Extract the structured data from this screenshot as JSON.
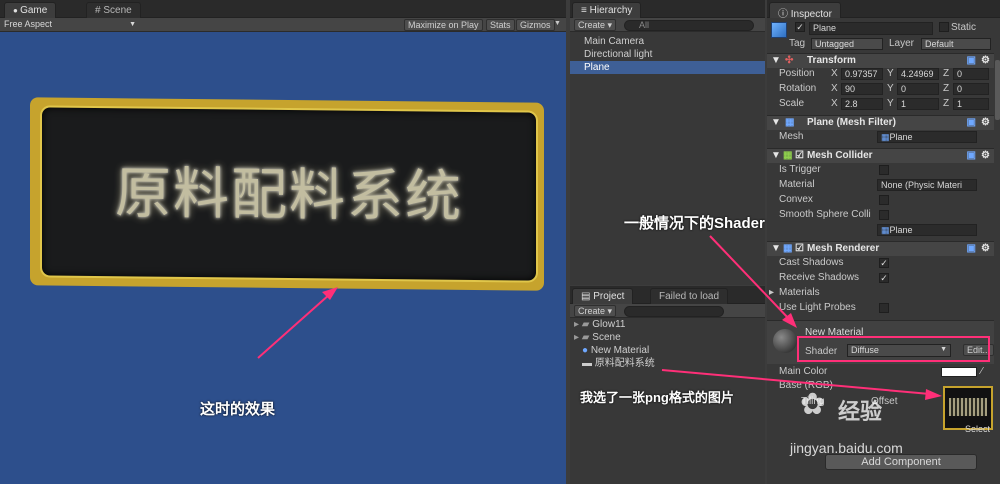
{
  "game": {
    "tab": "Game",
    "scene_tab": "Scene",
    "aspect": "Free Aspect",
    "buttons": [
      "Maximize on Play",
      "Stats",
      "Gizmos"
    ],
    "sign_text": "原料配料系统"
  },
  "hierarchy": {
    "tab": "Hierarchy",
    "create": "Create",
    "search": "All",
    "items": [
      "Main Camera",
      "Directional light",
      "Plane"
    ]
  },
  "project": {
    "tab": "Project",
    "tab2": "Failed to load",
    "create": "Create",
    "items": [
      "Glow11",
      "Scene",
      "New Material",
      "原料配料系统"
    ]
  },
  "inspector": {
    "tab": "Inspector",
    "object_name": "Plane",
    "static_label": "Static",
    "tag_label": "Tag",
    "tag_value": "Untagged",
    "layer_label": "Layer",
    "layer_value": "Default",
    "transform": {
      "title": "Transform",
      "position_label": "Position",
      "rotation_label": "Rotation",
      "scale_label": "Scale",
      "position": [
        "0.97357",
        "4.24969",
        "0"
      ],
      "rotation": [
        "90",
        "0",
        "0"
      ],
      "scale": [
        "2.8",
        "1",
        "1"
      ]
    },
    "mesh_filter": {
      "title": "Plane (Mesh Filter)",
      "mesh_label": "Mesh",
      "mesh_value": "Plane"
    },
    "mesh_collider": {
      "title": "Mesh Collider",
      "is_trigger": "Is Trigger",
      "material": "Material",
      "material_value": "None (Physic Materi",
      "convex": "Convex",
      "smooth": "Smooth Sphere Colli",
      "mesh_value": "Plane"
    },
    "mesh_renderer": {
      "title": "Mesh Renderer",
      "cast_shadows": "Cast Shadows",
      "receive_shadows": "Receive Shadows",
      "materials": "Materials",
      "light_probes": "Use Light Probes"
    },
    "material": {
      "name": "New Material",
      "shader_label": "Shader",
      "shader_value": "Diffuse",
      "edit": "Edit...",
      "main_color": "Main Color",
      "base": "Base (RGB)",
      "tiling": "Tiling",
      "offset": "Offset",
      "select": "Select"
    },
    "add_component": "Add Component"
  },
  "annotations": {
    "effect": "这时的效果",
    "shader_note": "一般情况下的Shader",
    "png_note": "我选了一张png格式的图片"
  },
  "watermark": {
    "text": "经验",
    "url": "jingyan.baidu.com"
  },
  "colors": {
    "scene_bg": "#2d4f8c",
    "highlight": "#ff2f78",
    "selection": "#3e5f96"
  }
}
